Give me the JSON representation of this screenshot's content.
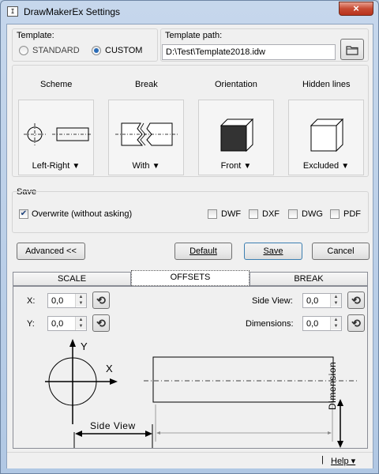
{
  "window": {
    "title": "DrawMakerEx Settings",
    "close_glyph": "×"
  },
  "template": {
    "label": "Template:",
    "options": [
      "STANDARD",
      "CUSTOM"
    ],
    "selected": "CUSTOM",
    "path_label": "Template path:",
    "path_value": "D:\\Test\\Template2018.idw"
  },
  "columns": [
    {
      "header": "Scheme",
      "value": "Left-Right"
    },
    {
      "header": "Break",
      "value": "With"
    },
    {
      "header": "Orientation",
      "value": "Front"
    },
    {
      "header": "Hidden lines",
      "value": "Excluded"
    }
  ],
  "dropdown_glyph": "▼",
  "save": {
    "label": "Save",
    "overwrite_label": "Overwrite (without asking)",
    "overwrite_checked": true,
    "formats": [
      "DWF",
      "DXF",
      "DWG",
      "PDF"
    ]
  },
  "buttons": {
    "advanced": "Advanced <<",
    "default": "Default",
    "save": "Save",
    "cancel": "Cancel"
  },
  "tabs": [
    {
      "label": "SCALE"
    },
    {
      "label": "OFFSETS"
    },
    {
      "label": "BREAK"
    }
  ],
  "active_tab": "OFFSETS",
  "offsets": {
    "x_label": "X:",
    "x_value": "0,0",
    "y_label": "Y:",
    "y_value": "0,0",
    "side_view_label": "Side View:",
    "side_view_value": "0,0",
    "dimensions_label": "Dimensions:",
    "dimensions_value": "0,0"
  },
  "diagram": {
    "y_axis": "Y",
    "x_axis": "X",
    "side_view": "Side View",
    "dimension": "Dimension"
  },
  "statusbar": {
    "separator": "|",
    "help": "Help ▾"
  }
}
